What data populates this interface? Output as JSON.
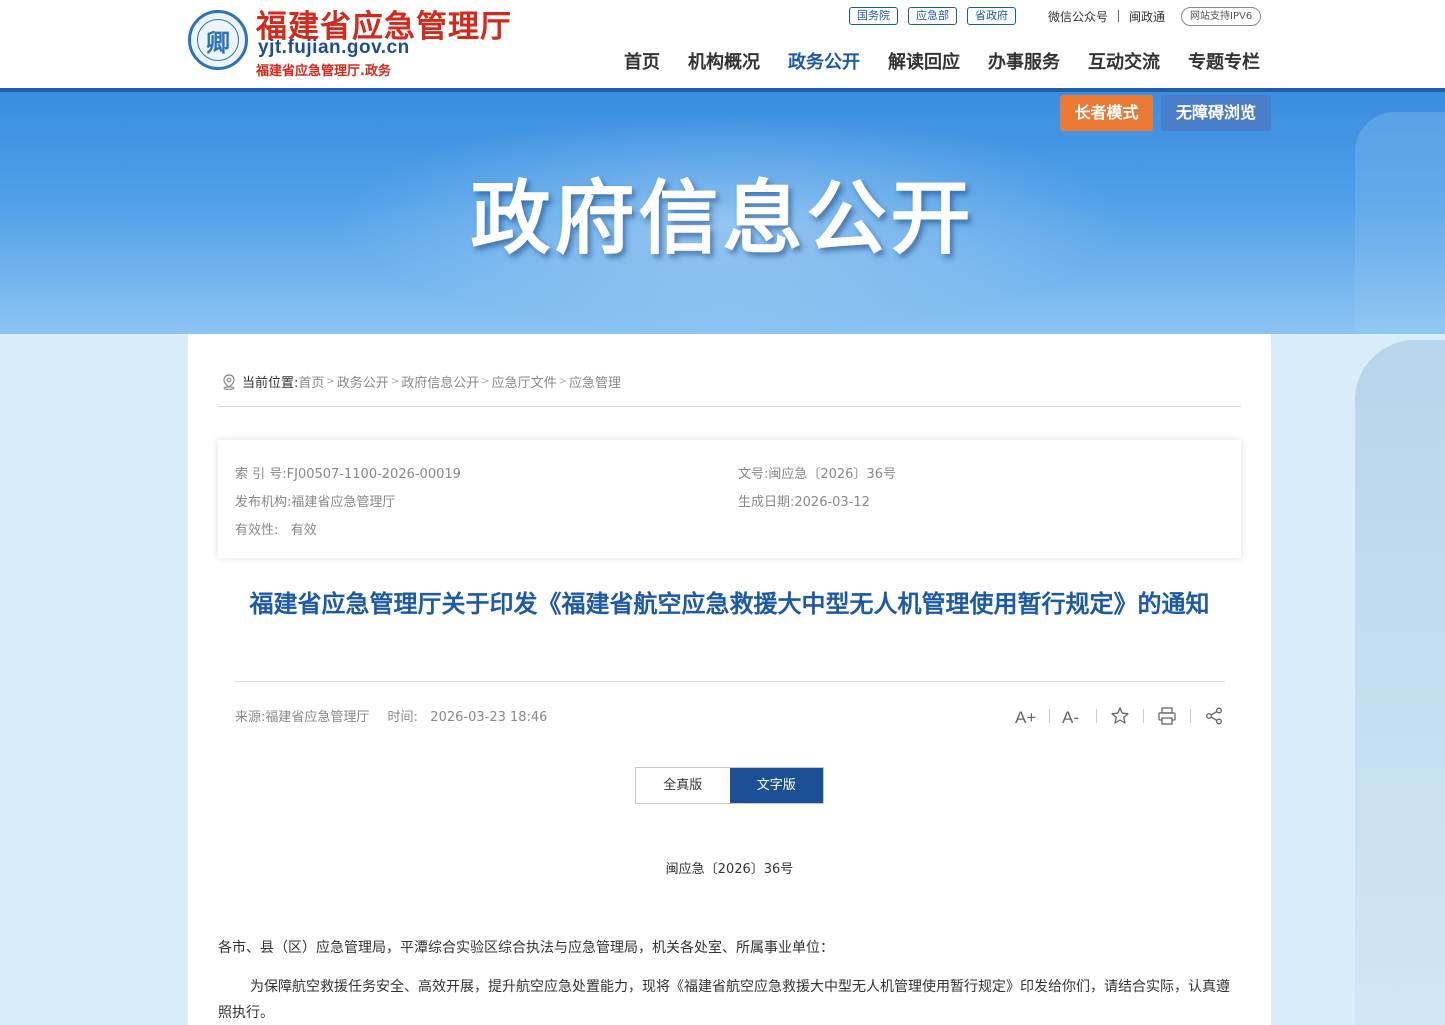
{
  "header": {
    "logo_glyph": "卿",
    "title": "福建省应急管理厅",
    "domain": "yjt.fujian.gov.cn",
    "subtitle": "福建省应急管理厅.政务",
    "top_pills": [
      "国务院",
      "应急部",
      "省政府"
    ],
    "wechat": "微信公众号",
    "minzhengtong": "闽政通",
    "ipv6": "网站支持IPV6",
    "nav": [
      "首页",
      "机构概况",
      "政务公开",
      "解读回应",
      "办事服务",
      "互动交流",
      "专题专栏"
    ],
    "active_nav": "政务公开"
  },
  "banner": {
    "title": "政府信息公开",
    "elder_mode": "长者模式",
    "accessible": "无障碍浏览"
  },
  "breadcrumb": {
    "label": "当前位置:",
    "items": [
      "首页",
      "政务公开",
      "政府信息公开",
      "应急厅文件",
      "应急管理"
    ]
  },
  "meta": {
    "index_no": "索 引 号:FJ00507-1100-2026-00019",
    "doc_no": "文号:闽应急〔2026〕36号",
    "publisher": "发布机构:福建省应急管理厅",
    "created": "生成日期:2026-03-12",
    "validity": "有效性:   有效"
  },
  "article": {
    "title": "福建省应急管理厅关于印发《福建省航空应急救援大中型无人机管理使用暂行规定》的通知",
    "source": "来源:福建省应急管理厅",
    "time": "时间:   2026-03-23 18:46",
    "doc_number": "闽应急〔2026〕36号",
    "addressee": "各市、县（区）应急管理局，平潭综合实验区综合执法与应急管理局，机关各处室、所属事业单位：",
    "paragraph": "为保障航空救援任务安全、高效开展，提升航空应急处置能力，现将《福建省航空应急救援大中型无人机管理使用暂行规定》印发给你们，请结合实际，认真遵照执行。"
  },
  "versions": {
    "full": "全真版",
    "text": "文字版",
    "active": "文字版"
  },
  "tools": {
    "font_larger": "A+",
    "font_smaller": "A-",
    "icons": [
      "font-larger-icon",
      "font-smaller-icon",
      "star-icon",
      "print-icon",
      "share-icon"
    ]
  },
  "colors": {
    "brand_red": "#d32a1c",
    "brand_blue": "#1d5aa6",
    "elder_orange": "#ea7a33",
    "accessible_blue": "#4a7ecb",
    "active_version": "#1d4f97"
  }
}
